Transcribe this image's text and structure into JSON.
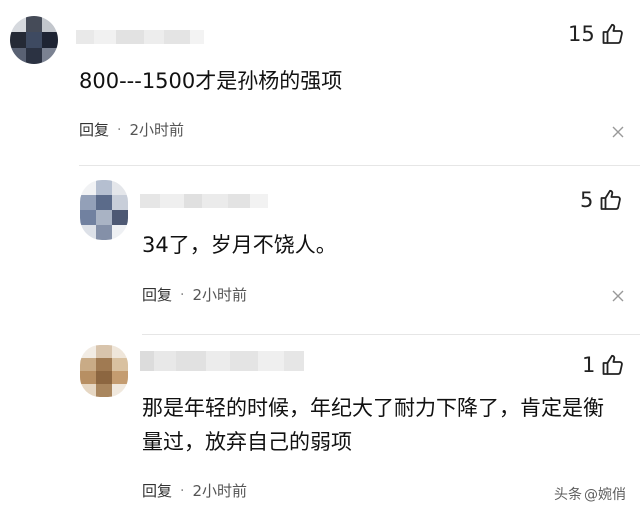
{
  "comments": [
    {
      "text": "800---1500才是孙杨的强项",
      "likes": "15",
      "reply_label": "回复",
      "separator": "·",
      "time": "2小时前"
    },
    {
      "text": "34了，岁月不饶人。",
      "likes": "5",
      "reply_label": "回复",
      "separator": "·",
      "time": "2小时前"
    },
    {
      "text_line1": "那是年轻的时候，年纪大了耐力下降了，肯定是衡",
      "text_line2": "量过，放弃自己的弱项",
      "likes": "1",
      "reply_label": "回复",
      "separator": "·",
      "time": "2小时前"
    }
  ],
  "watermark": {
    "brand": "头条",
    "handle": "@婉俏"
  },
  "icons": {
    "like": "thumbs-up-icon",
    "close": "close-icon"
  },
  "colors": {
    "text": "#111111",
    "meta": "#555555",
    "divider": "#e6e6e6"
  }
}
